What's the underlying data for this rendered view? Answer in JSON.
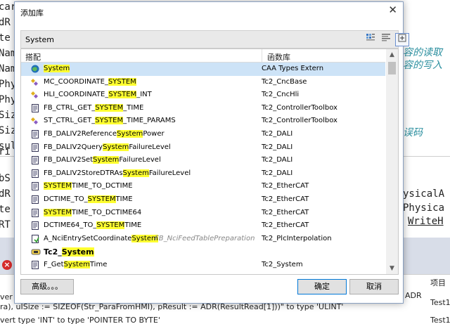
{
  "background": {
    "code_left": [
      "car",
      "dR",
      "te",
      "Nam",
      "Nam",
      "Phy",
      "Phy",
      "Siz",
      "Siz",
      "sul",
      "ri",
      "bS",
      "dR",
      "te",
      "RT"
    ],
    "comment_1": "容的读取",
    "comment_2": "容的写入",
    "comment_3": "误码",
    "code_right": [
      "ysicalA",
      "Physica",
      "WriteH"
    ],
    "bottom_lines": [
      "ra), uISize := SIZEOF(Str_ParaFromHMI), pResult := ADR(ResultRead[1]))\" to type 'ULINT'",
      "vert type 'INT' to type 'POINTER TO BYTE'"
    ],
    "right_col_header": "项目",
    "right_adr": "ADR",
    "test_1": "Test1",
    "test_2": "Test1",
    "over_1": "ver",
    "over_2": "ver"
  },
  "dialog": {
    "title": "添加库",
    "search_value": "System",
    "col_match": "搭配",
    "col_library": "函数库",
    "advanced_button": "高级。。。",
    "ok_button": "确定",
    "cancel_button": "取消"
  },
  "rows": [
    {
      "icon": "globe-icon",
      "pre": "",
      "hl": "System",
      "post": "",
      "note": "",
      "library": "CAA Types Extern",
      "selected": true
    },
    {
      "icon": "struct-icon",
      "pre": "MC_COORDINATE_",
      "hl": "SYSTEM",
      "post": "",
      "note": "",
      "library": "Tc2_CncBase"
    },
    {
      "icon": "struct-icon",
      "pre": "HLI_COORDINATE_",
      "hl": "SYSTEM",
      "post": "_INT",
      "note": "",
      "library": "Tc2_CncHli"
    },
    {
      "icon": "fb-icon",
      "pre": "FB_CTRL_GET_",
      "hl": "SYSTEM",
      "post": "_TIME",
      "note": "",
      "library": "Tc2_ControllerToolbox"
    },
    {
      "icon": "struct-icon",
      "pre": "ST_CTRL_GET_",
      "hl": "SYSTEM",
      "post": "_TIME_PARAMS",
      "note": "",
      "library": "Tc2_ControllerToolbox"
    },
    {
      "icon": "fb-icon",
      "pre": "FB_DALIV2Reference",
      "hl": "System",
      "post": "Power",
      "note": "",
      "library": "Tc2_DALI"
    },
    {
      "icon": "fb-icon",
      "pre": "FB_DALIV2Query",
      "hl": "System",
      "post": "FailureLevel",
      "note": "",
      "library": "Tc2_DALI"
    },
    {
      "icon": "fb-icon",
      "pre": "FB_DALIV2Set",
      "hl": "System",
      "post": "FailureLevel",
      "note": "",
      "library": "Tc2_DALI"
    },
    {
      "icon": "fb-icon",
      "pre": "FB_DALIV2StoreDTRAs",
      "hl": "System",
      "post": "FailureLevel",
      "note": "",
      "library": "Tc2_DALI"
    },
    {
      "icon": "fb-icon",
      "pre": "",
      "hl": "SYSTEM",
      "post": "TIME_TO_DCTIME",
      "note": "",
      "library": "Tc2_EtherCAT"
    },
    {
      "icon": "fb-icon",
      "pre": "DCTIME_TO_",
      "hl": "SYSTEM",
      "post": "TIME",
      "note": "",
      "library": "Tc2_EtherCAT"
    },
    {
      "icon": "fb-icon",
      "pre": "",
      "hl": "SYSTEM",
      "post": "TIME_TO_DCTIME64",
      "note": "",
      "library": "Tc2_EtherCAT"
    },
    {
      "icon": "fb-icon",
      "pre": "DCTIME64_TO_",
      "hl": "SYSTEM",
      "post": "TIME",
      "note": "",
      "library": "Tc2_EtherCAT"
    },
    {
      "icon": "action-icon",
      "pre": "A_NciEntrySetCoordinate",
      "hl": "System",
      "post": "",
      "note": "FB_NciFeedTablePreparation",
      "library": "Tc2_PlcInterpolation"
    },
    {
      "icon": "library-icon",
      "pre": "Tc2_",
      "hl": "System",
      "post": "",
      "note": "",
      "library": "",
      "bold": true
    },
    {
      "icon": "fb-icon",
      "pre": "F_Get",
      "hl": "System",
      "post": "Time",
      "note": "",
      "library": "Tc2_System"
    }
  ],
  "colors": {
    "highlight": "#ffff30",
    "selection": "#cde3f7",
    "accent": "#0078d7"
  }
}
